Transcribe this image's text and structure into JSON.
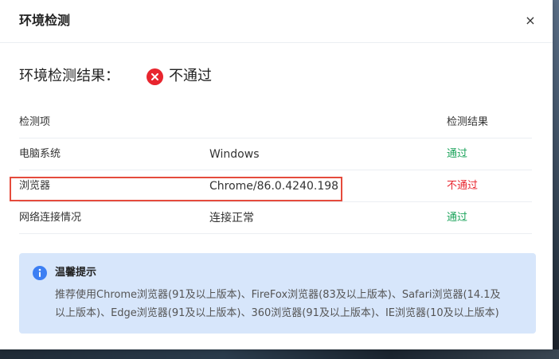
{
  "dialog": {
    "title": "环境检测",
    "close_label": "×"
  },
  "result": {
    "label": "环境检测结果：",
    "value": "不通过",
    "status_color": "#e8252e"
  },
  "table": {
    "headers": [
      "检测项",
      "",
      "检测结果"
    ],
    "rows": [
      {
        "item": "电脑系统",
        "detail": "Windows",
        "status": "通过"
      },
      {
        "item": "浏览器",
        "detail": "Chrome/86.0.4240.198",
        "status": "不通过"
      },
      {
        "item": "网络连接情况",
        "detail": "连接正常",
        "status": "通过"
      }
    ]
  },
  "tip": {
    "title": "温馨提示",
    "body_line1": "推荐使用Chrome浏览器(91及以上版本)、FireFox浏览器(83及以上版本)、Safari浏览器(14.1及",
    "body_line2": "以上版本)、Edge浏览器(91及以上版本)、360浏览器(91及以上版本)、IE浏览器(10及以上版本)"
  },
  "colors": {
    "pass": "#1aa35a",
    "fail": "#e8252e",
    "info": "#3d7ff3",
    "highlight": "#e54b3c"
  }
}
